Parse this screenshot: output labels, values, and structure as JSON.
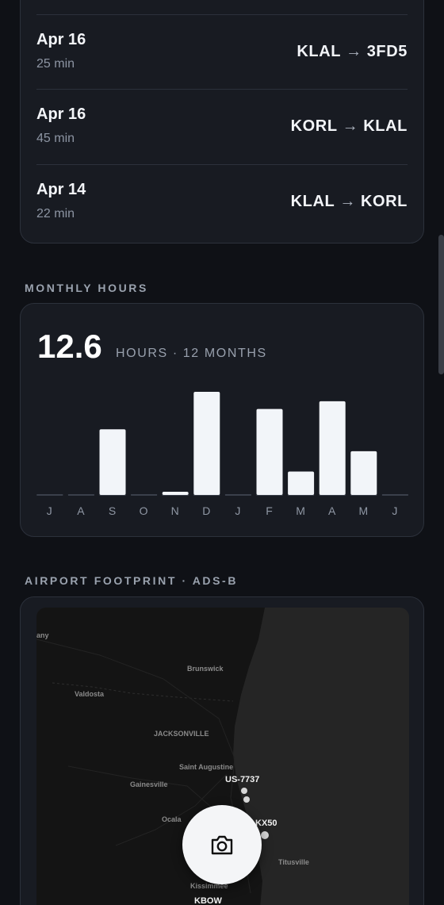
{
  "flights": [
    {
      "date": "Apr 16",
      "duration": "25 min",
      "from": "KLAL",
      "arrow": "→",
      "to": "3FD5"
    },
    {
      "date": "Apr 16",
      "duration": "45 min",
      "from": "KORL",
      "arrow": "→",
      "to": "KLAL"
    },
    {
      "date": "Apr 14",
      "duration": "22 min",
      "from": "KLAL",
      "arrow": "→",
      "to": "KORL"
    }
  ],
  "monthly_hours": {
    "section_title": "MONTHLY HOURS",
    "total": "12.6",
    "subtitle": "HOURS · 12 MONTHS"
  },
  "chart_data": {
    "type": "bar",
    "categories": [
      "J",
      "A",
      "S",
      "O",
      "N",
      "D",
      "J",
      "F",
      "M",
      "A",
      "M",
      "J"
    ],
    "values": [
      0,
      0,
      2.1,
      0,
      0.1,
      3.3,
      0,
      2.75,
      0.75,
      3.0,
      1.4,
      0
    ],
    "ylim": [
      0,
      3.3
    ],
    "bar_color": "#f2f5f9",
    "baseline_color": "#3a404b",
    "grid": false
  },
  "footprint": {
    "section_title": "AIRPORT FOOTPRINT · ADS-B",
    "place_labels": [
      "Brunswick",
      "Valdosta",
      "JACKSONVILLE",
      "Saint Augustine",
      "Gainesville",
      "Ocala",
      "Titusville",
      "Kissimmee",
      "any"
    ],
    "markers": [
      "US-7737",
      "KX50",
      "KBOW"
    ]
  },
  "camera_icon": "camera-icon",
  "colors": {
    "background": "#0f1116",
    "card": "#181b22",
    "card_border": "#2c313b",
    "map_land": "#141414",
    "map_water": "#252525"
  }
}
